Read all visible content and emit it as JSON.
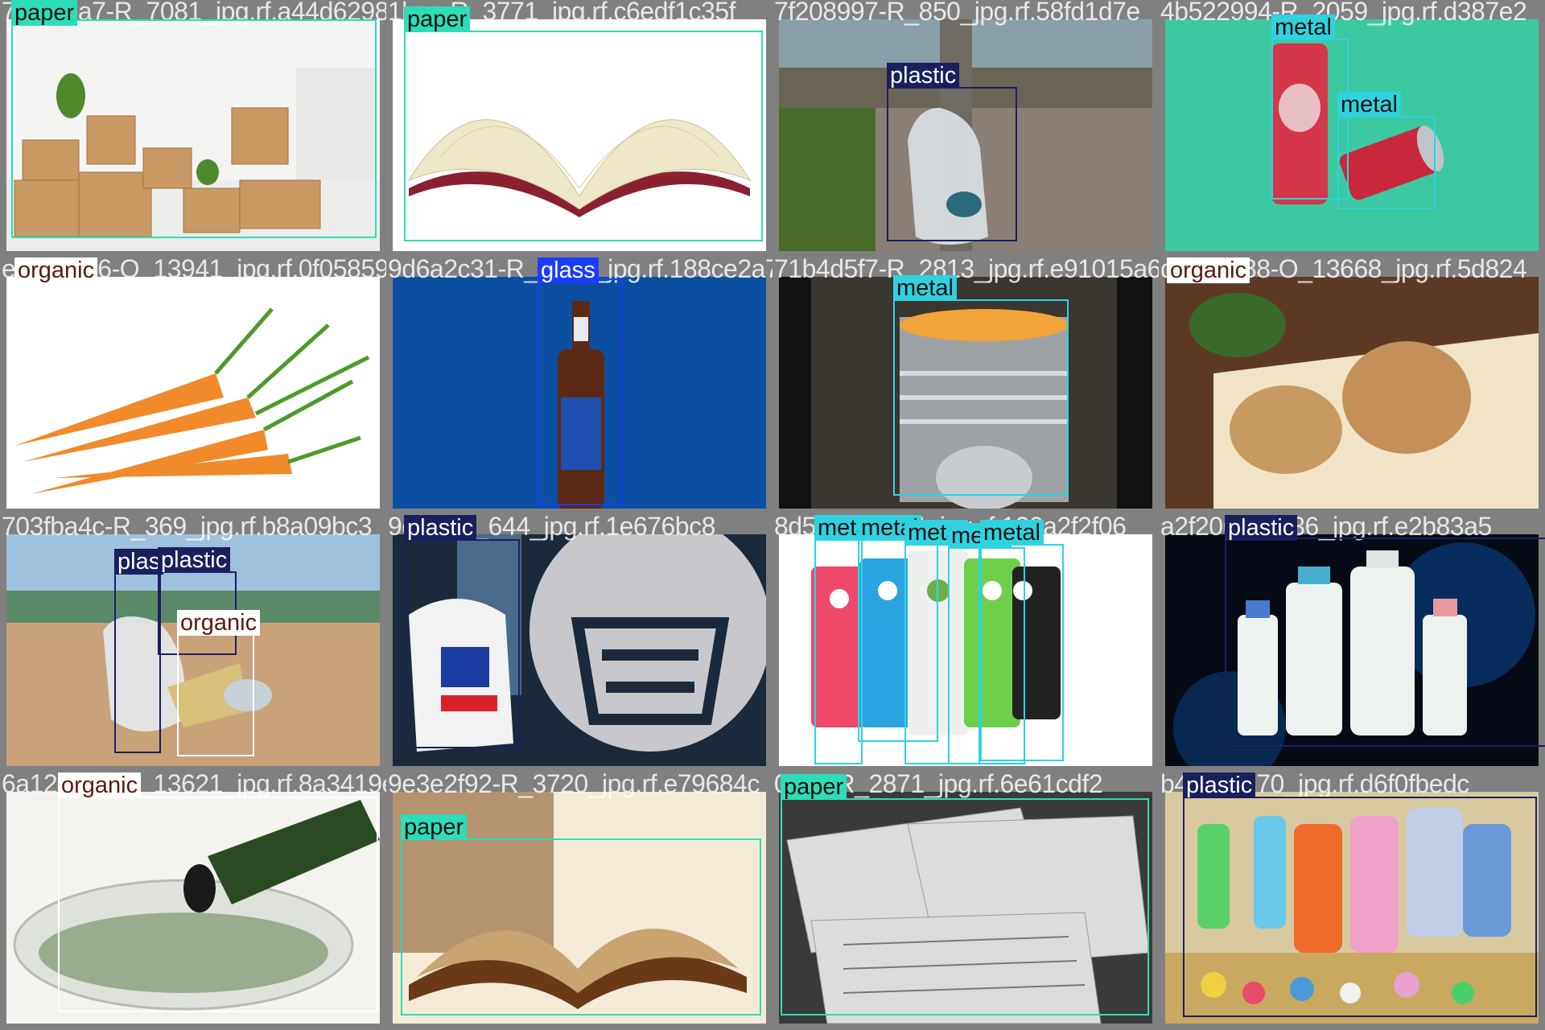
{
  "colors": {
    "paper": "#2ddcb8",
    "plastic": "#1a1f5e",
    "metal": "#2fd3e0",
    "glass": "#1a3cff",
    "organic": "#ffffff",
    "organic_text": "#5a1a10"
  },
  "tiles": [
    {
      "file": "7f23b3a7-R_7081_jpg.rf.a44d6298",
      "scene": "cardboard-boxes-room",
      "labels": [
        {
          "cls": "paper",
          "text": "paper"
        }
      ]
    },
    {
      "file": "1bac-R_3771_jpg.rf.c6edf1c35f",
      "scene": "open-book-white",
      "labels": [
        {
          "cls": "paper",
          "text": "paper"
        }
      ]
    },
    {
      "file": "7f208997-R_850_jpg.rf.58fd1d7e",
      "scene": "plastic-bag-street",
      "labels": [
        {
          "cls": "plastic",
          "text": "plastic"
        }
      ]
    },
    {
      "file": "4b522994-R_2059_jpg.rf.d387e2",
      "scene": "soda-cans-teal",
      "labels": [
        {
          "cls": "metal",
          "text": "metal"
        },
        {
          "cls": "metal",
          "text": "metal"
        }
      ]
    },
    {
      "file": "e02a0c96-O_13941_jpg.rf.0f058591",
      "scene": "carrots",
      "labels": [
        {
          "cls": "organic",
          "text": "organic"
        }
      ]
    },
    {
      "file": "9d6a2c31-R_4159_jpg.rf.188ce2a7",
      "scene": "beer-bottle-blue",
      "labels": [
        {
          "cls": "glass",
          "text": "glass"
        }
      ]
    },
    {
      "file": "71b4d5f7-R_2813_jpg.rf.e91015a6",
      "scene": "tin-can-stove",
      "labels": [
        {
          "cls": "metal",
          "text": "metal"
        }
      ]
    },
    {
      "file": "dbb4ce88-O_13668_jpg.rf.5d824",
      "scene": "potatoes-plate",
      "labels": [
        {
          "cls": "organic",
          "text": "organic"
        }
      ]
    },
    {
      "file": "703fba4c-R_369_jpg.rf.b8a09bc3",
      "scene": "beach-litter",
      "labels": [
        {
          "cls": "plastic",
          "text": "plas"
        },
        {
          "cls": "plastic",
          "text": "plastic"
        },
        {
          "cls": "organic",
          "text": "organic"
        }
      ]
    },
    {
      "file": "9c96_R_644_jpg.rf.1e676bc8",
      "scene": "tesco-bag",
      "labels": [
        {
          "cls": "plastic",
          "text": "plastic"
        }
      ]
    },
    {
      "file": "8d55-R_1264_jpg.rf.130a2f2f06",
      "scene": "less-soda-cans",
      "labels": [
        {
          "cls": "metal",
          "text": "metal"
        },
        {
          "cls": "metal",
          "text": "metal"
        },
        {
          "cls": "metal",
          "text": "metal"
        },
        {
          "cls": "metal",
          "text": "metal"
        },
        {
          "cls": "metal",
          "text": "metal"
        }
      ]
    },
    {
      "file": "a2f206-R_336_jpg.rf.e2b83a5",
      "scene": "white-bottles-dark",
      "labels": [
        {
          "cls": "plastic",
          "text": "plastic"
        }
      ]
    },
    {
      "file": "6a12c89d-O_13621_jpg.rf.8a3419e",
      "scene": "cucumber-bowl",
      "labels": [
        {
          "cls": "organic",
          "text": "organic"
        }
      ]
    },
    {
      "file": "9e3e2f92-R_3720_jpg.rf.e79684c",
      "scene": "old-book-brown",
      "labels": [
        {
          "cls": "paper",
          "text": "paper"
        }
      ]
    },
    {
      "file": "0c6e-R_2871_jpg.rf.6e61cdf2",
      "scene": "newspapers-bw",
      "labels": [
        {
          "cls": "paper",
          "text": "paper"
        }
      ]
    },
    {
      "file": "b4-R_1370_jpg.rf.d6f0fbedc",
      "scene": "colorful-plastic-bottles",
      "labels": [
        {
          "cls": "plastic",
          "text": "plastic"
        }
      ]
    }
  ]
}
